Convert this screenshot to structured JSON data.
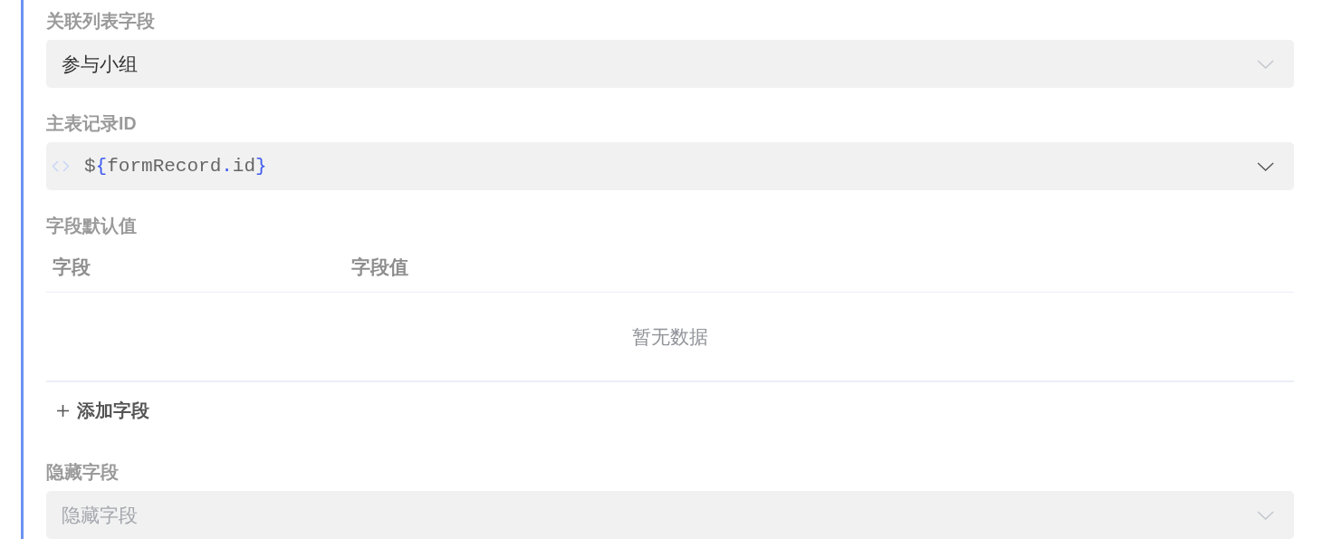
{
  "sections": [
    {
      "kind": "select",
      "label": "关联列表字段",
      "value": "参与小组"
    },
    {
      "kind": "expression",
      "label": "主表记录ID",
      "value": "${formRecord.id}"
    },
    {
      "kind": "table",
      "label": "字段默认值",
      "columns": [
        "字段",
        "字段值"
      ],
      "empty_text": "暂无数据",
      "add_button": "添加字段"
    },
    {
      "kind": "select",
      "label": "隐藏字段",
      "placeholder": "隐藏字段"
    }
  ]
}
